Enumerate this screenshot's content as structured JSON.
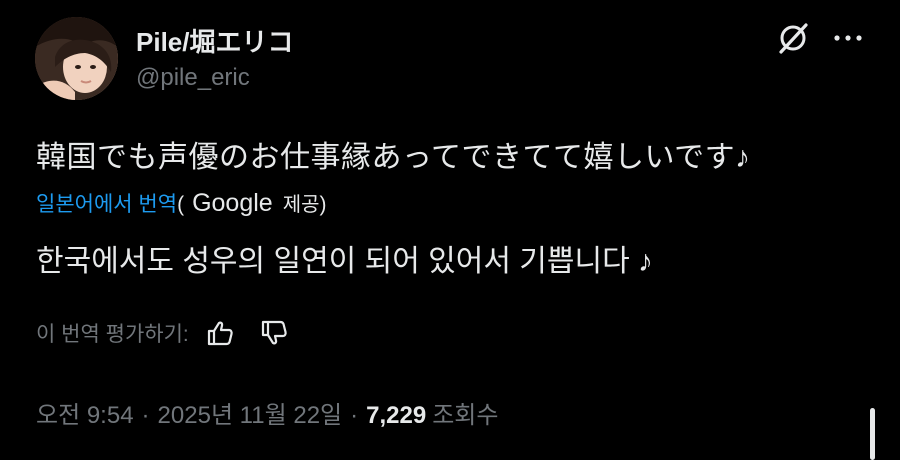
{
  "author": {
    "display_name": "Pile/堀エリコ",
    "handle": "@pile_eric",
    "avatar_icon": "profile-photo"
  },
  "header_actions": {
    "grok_icon": "grok-icon",
    "more_icon": "more-horizontal-icon"
  },
  "tweet": {
    "text": "韓国でも声優のお仕事縁あってできてて嬉しいです♪"
  },
  "translation": {
    "link_label": "일본어에서 번역",
    "paren_open": "(",
    "provider": "Google",
    "provided_label": "제공",
    "paren_close": ")",
    "translated_text": "한국에서도 성우의 일연이 되어 있어서 기쁩니다 ♪",
    "rate_label": "이 번역 평가하기:",
    "thumbs_up_icon": "thumbs-up-icon",
    "thumbs_down_icon": "thumbs-down-icon"
  },
  "meta": {
    "time": "오전 9:54",
    "separator": "·",
    "date": "2025년 11월 22일",
    "views_count": "7,229",
    "views_label": "조회수"
  },
  "colors": {
    "background": "#000000",
    "text_primary": "#e7e9ea",
    "text_secondary": "#71767b",
    "link": "#1d9bf0"
  }
}
